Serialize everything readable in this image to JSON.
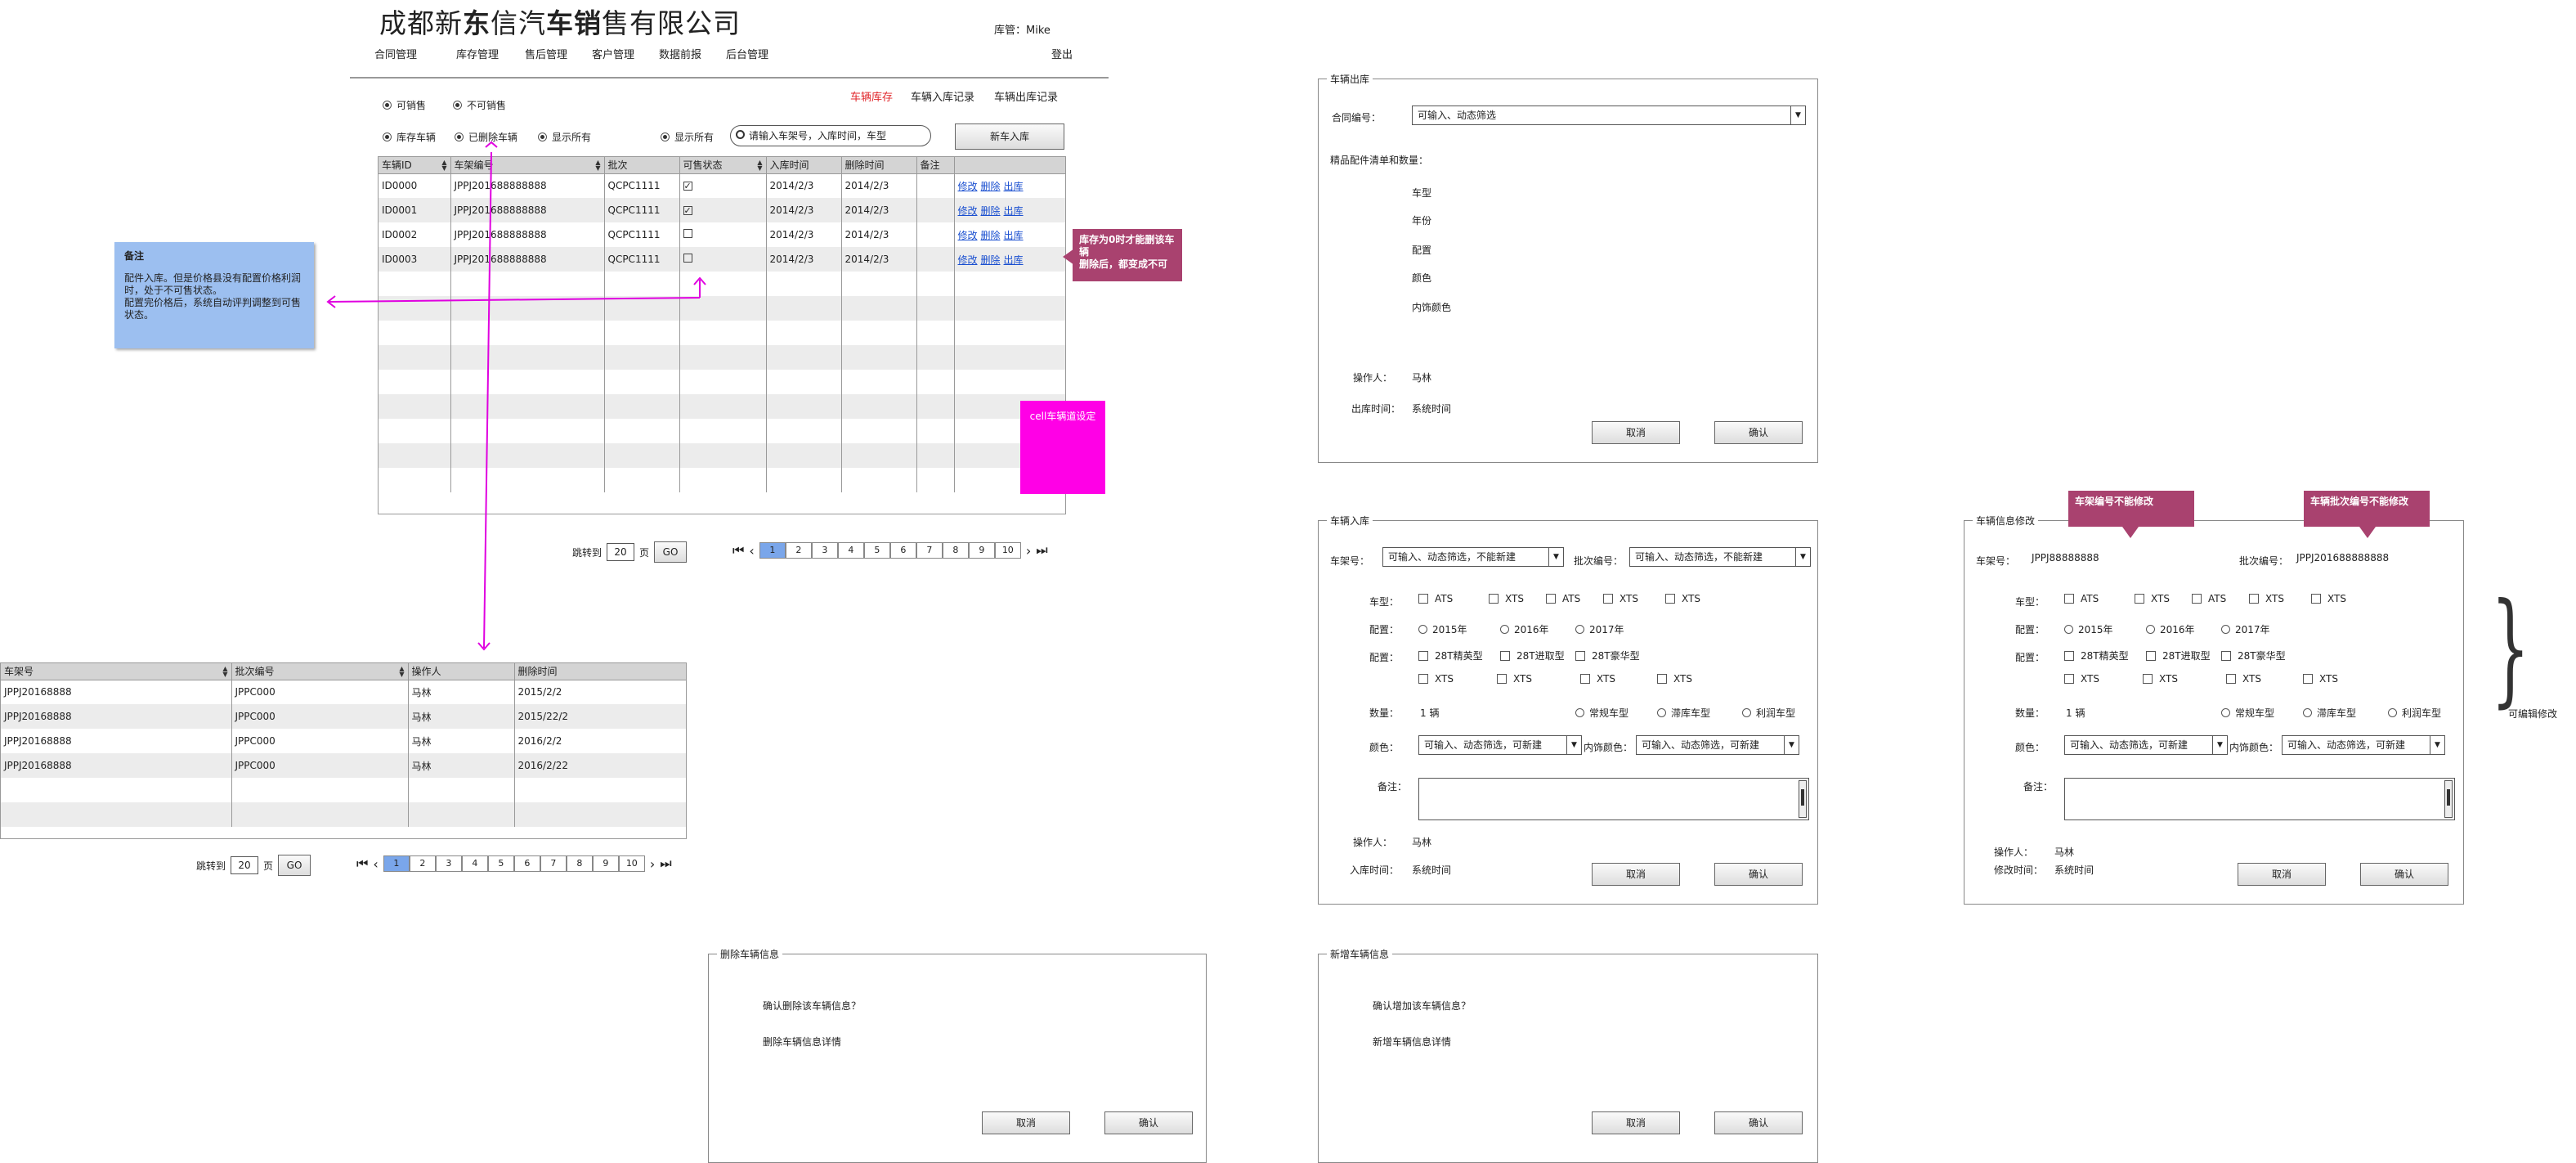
{
  "header": {
    "company_plain1": "成都新",
    "company_bold1": "东",
    "company_plain2": "信汽",
    "company_bold2": "车销",
    "company_plain3": "售有限公司",
    "user_label": "库管：Mike",
    "logout": "登出",
    "nav": [
      "合同管理",
      "库存管理",
      "售后管理",
      "客户管理",
      "数据前报",
      "后台管理"
    ]
  },
  "subtabs": [
    "车辆库存",
    "车辆入库记录",
    "车辆出库记录"
  ],
  "filters": {
    "sale_opts": [
      "可销售",
      "不可销售"
    ],
    "view_opts": [
      "库存车辆",
      "已删除车辆",
      "显示所有"
    ],
    "show_all": "显示所有",
    "search_placeholder": "请输入车架号，入库时间，车型",
    "new_in_button": "新车入库"
  },
  "main_table": {
    "columns": [
      "车辆ID",
      "车架编号",
      "批次",
      "可售状态",
      "入库时间",
      "删除时间",
      "备注",
      ""
    ],
    "rows": [
      {
        "id": "ID0000",
        "vin": "JPPJ201688888888",
        "batch": "QCPC1111",
        "checked": true,
        "in": "2014/2/3",
        "del": "2014/2/3"
      },
      {
        "id": "ID0001",
        "vin": "JPPJ201688888888",
        "batch": "QCPC1111",
        "checked": true,
        "in": "2014/2/3",
        "del": "2014/2/3"
      },
      {
        "id": "ID0002",
        "vin": "JPPJ201688888888",
        "batch": "QCPC1111",
        "checked": false,
        "in": "2014/2/3",
        "del": "2014/2/3"
      },
      {
        "id": "ID0003",
        "vin": "JPPJ201688888888",
        "batch": "QCPC1111",
        "checked": false,
        "in": "2014/2/3",
        "del": "2014/2/3"
      }
    ],
    "actions": [
      "修改",
      "删除",
      "出库"
    ]
  },
  "pager": {
    "jump": "跳转到",
    "size": "20",
    "unit": "页",
    "go": "GO",
    "pages": [
      "1",
      "2",
      "3",
      "4",
      "5",
      "6",
      "7",
      "8",
      "9",
      "10"
    ]
  },
  "note": {
    "title": "备注",
    "body": "配件入库。但是价格县没有配置价格利润时，处于不可售状态。\n配置完价格后，系统自动评判调整到可售状态。"
  },
  "tip_delete": "库存为0时才能删该车辆\n删除后，都变成不可",
  "magenta_note": "cell车辆道设定",
  "deleted_table": {
    "columns": [
      "车架号",
      "批次编号",
      "操作人",
      "删除时间"
    ],
    "rows": [
      [
        "JPPJ20168888",
        "JPPC000",
        "马林",
        "2015/2/2"
      ],
      [
        "JPPJ20168888",
        "JPPC000",
        "马林",
        "2015/22/2"
      ],
      [
        "JPPJ20168888",
        "JPPC000",
        "马林",
        "2016/2/2"
      ],
      [
        "JPPJ20168888",
        "JPPC000",
        "马林",
        "2016/2/22"
      ]
    ]
  },
  "delete_dialog": {
    "legend": "删除车辆信息",
    "q": "确认删除该车辆信息？",
    "detail": "删除车辆信息详情",
    "cancel": "取消",
    "ok": "确认"
  },
  "outbound": {
    "legend": "车辆出库",
    "contract_label": "合同编号：",
    "contract_ph": "可输入、动态筛选",
    "parts_label": "精品配件清单和数量：",
    "fields": [
      "车型",
      "年份",
      "配置",
      "颜色",
      "内饰颜色"
    ],
    "operator_label": "操作人：",
    "operator": "马林",
    "time_label": "出库时间：",
    "time": "系统时间",
    "cancel": "取消",
    "ok": "确认"
  },
  "inbound": {
    "legend": "车辆入库",
    "vin_label": "车架号：",
    "vin_ph": "可输入、动态筛选，不能新建",
    "batch_label": "批次编号：",
    "batch_ph": "可输入、动态筛选，不能新建",
    "model_label": "车型：",
    "models": [
      "ATS",
      "XTS",
      "ATS",
      "XTS",
      "XTS"
    ],
    "config_label": "配置：",
    "years": [
      "2015年",
      "2016年",
      "2017年"
    ],
    "config_label2": "配置：",
    "trims": [
      "28T精英型",
      "28T进取型",
      "28T豪华型"
    ],
    "trims2": [
      "XTS",
      "XTS",
      "XTS",
      "XTS"
    ],
    "qty_label": "数量：",
    "qty": "1 辆",
    "kinds": [
      "常规车型",
      "滞库车型",
      "利润车型"
    ],
    "color_label": "颜色：",
    "color_ph": "可输入、动态筛选，可新建",
    "inner_label": "内饰颜色：",
    "inner_ph": "可输入、动态筛选，可新建",
    "remark_label": "备注：",
    "operator_label": "操作人：",
    "operator": "马林",
    "time_label": "入库时间：",
    "time": "系统时间",
    "cancel": "取消",
    "ok": "确认"
  },
  "add_dialog": {
    "legend": "新增车辆信息",
    "q": "确认增加该车辆信息？",
    "detail": "新增车辆信息详情",
    "cancel": "取消",
    "ok": "确认"
  },
  "edit": {
    "legend": "车辆信息修改",
    "tip1": "车架编号不能修改",
    "tip2": "车辆批次编号不能修改",
    "vin_label": "车架号：",
    "vin": "JPPJ88888888",
    "batch_label": "批次编号：",
    "batch": "JPPJ201688888888",
    "editable": "可编辑修改",
    "modify_time_label": "修改时间：",
    "cancel": "取消",
    "ok": "确认"
  },
  "colors": {
    "accent_red": "#e0252a",
    "tip_bg": "#a9426f",
    "magenta": "#ff00e6",
    "note_bg": "#9cbff0",
    "page_on": "#7aa6ea"
  }
}
